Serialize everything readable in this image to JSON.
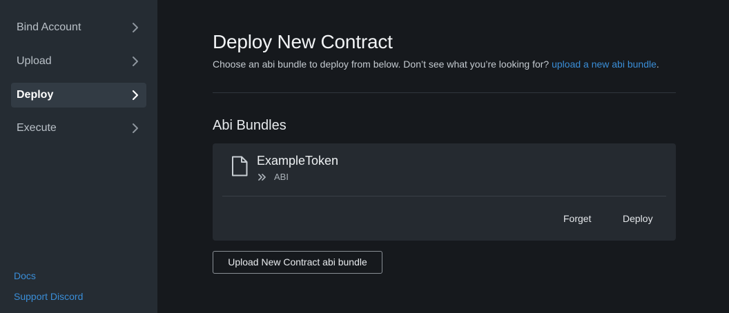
{
  "sidebar": {
    "items": [
      {
        "label": "Bind Account",
        "active": false
      },
      {
        "label": "Upload",
        "active": false
      },
      {
        "label": "Deploy",
        "active": true
      },
      {
        "label": "Execute",
        "active": false
      }
    ],
    "links": {
      "docs": "Docs",
      "support": "Support Discord"
    }
  },
  "main": {
    "title": "Deploy New Contract",
    "subtitle": "Choose an abi bundle to deploy from below. Don’t see what you’re looking for?",
    "subtitle_link": "upload a new abi bundle",
    "subtitle_end": ".",
    "section_title": "Abi Bundles",
    "bundles": [
      {
        "name": "ExampleToken",
        "type": "ABI",
        "forget_label": "Forget",
        "deploy_label": "Deploy"
      }
    ],
    "upload_button_label": "Upload New Contract abi bundle"
  },
  "icons": {
    "nav_chevron": "chevron-right-icon",
    "bundle_file": "file-icon",
    "bundle_type": "double-chevron-right-icon"
  },
  "colors": {
    "link": "#3a8ed8",
    "sidebar_bg": "#252c33",
    "main_bg": "#16191d",
    "card_bg": "#252a30",
    "active_item_bg": "#323b44"
  }
}
